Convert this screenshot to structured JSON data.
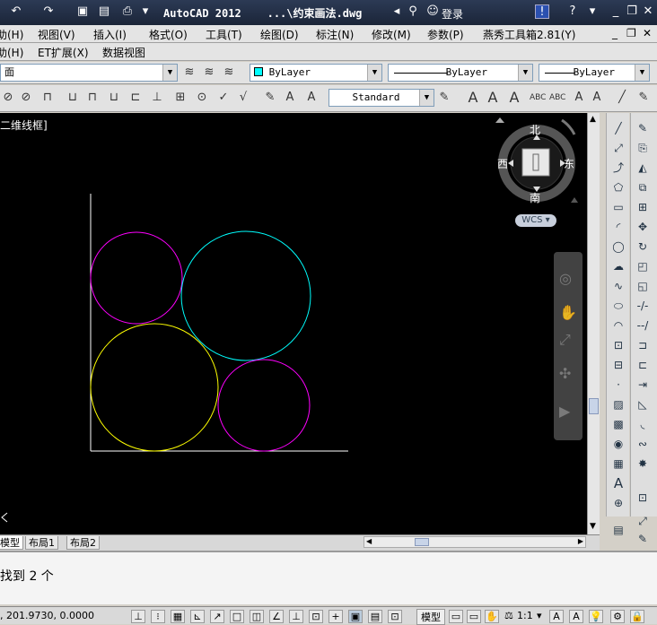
{
  "window": {
    "title": "AutoCAD 2012    ...\\约束画法.dwg",
    "login_label": "登录"
  },
  "menu": [
    {
      "label": "助(H)"
    },
    {
      "label": "视图(V)"
    },
    {
      "label": "插入(I)"
    },
    {
      "label": "格式(O)"
    },
    {
      "label": "工具(T)"
    },
    {
      "label": "绘图(D)"
    },
    {
      "label": "标注(N)"
    },
    {
      "label": "修改(M)"
    },
    {
      "label": "参数(P)"
    },
    {
      "label": "燕秀工具箱2.81(Y)"
    }
  ],
  "menu2": [
    {
      "label": "助(H)"
    },
    {
      "label": "ET扩展(X)"
    },
    {
      "label": "数据视图"
    }
  ],
  "toolbar": {
    "workspace_value": "面",
    "color_value": "ByLayer",
    "linetype_value": "ByLayer",
    "lineweight_value": "ByLayer",
    "dimstyle_value": "Standard"
  },
  "viewport": {
    "label": "二维线框]",
    "compass_north": "北",
    "compass_south": "南",
    "compass_east": "东",
    "compass_west": "西",
    "ucs_label": "WCS"
  },
  "tabs": [
    "模型",
    "布局1",
    "布局2"
  ],
  "command": {
    "text": "找到 2 个"
  },
  "status": {
    "coords": ", 201.9730, 0.0000",
    "model_label": "模型",
    "scale_label": "1:1"
  },
  "colors": {
    "circle_magenta": "#ff00ff",
    "circle_cyan": "#00ffff",
    "circle_yellow": "#ffff00"
  }
}
